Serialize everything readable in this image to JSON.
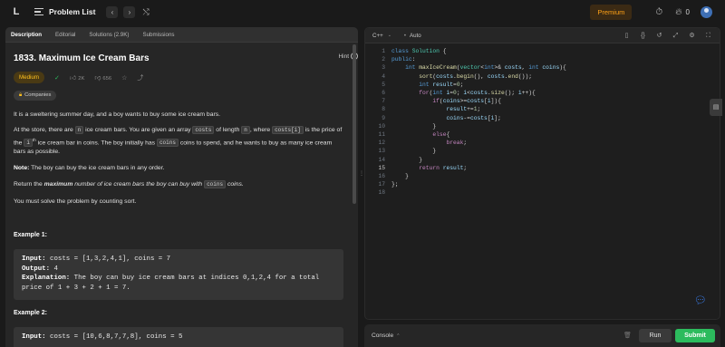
{
  "topbar": {
    "logo": "L",
    "title": "Problem List",
    "prev": "‹",
    "next": "›",
    "shuffle": "⤭",
    "premium": "Premium",
    "fire_count": "0"
  },
  "tabs": [
    "Description",
    "Editorial",
    "Solutions (2.9K)",
    "Submissions"
  ],
  "problem": {
    "title": "1833. Maximum Ice Cream Bars",
    "hint": "Hint",
    "difficulty": "Medium",
    "likes": "2K",
    "dislikes": "656",
    "companies": "Companies"
  },
  "description": {
    "p1": "It is a sweltering summer day, and a boy wants to buy some ice cream bars.",
    "p2_a": "At the store, there are ",
    "p2_n1": "n",
    "p2_b": " ice cream bars. You are given an array ",
    "p2_costs": "costs",
    "p2_c": " of length ",
    "p2_n2": "n",
    "p2_d": ", where ",
    "p2_costsi": "costs[i]",
    "p2_e": " is the price of the ",
    "p2_ith": "i",
    "p2_th": "th",
    "p2_f": " ice cream bar in coins. The boy initially has ",
    "p2_coins": "coins",
    "p2_g": " coins to spend, and he wants to buy as many ice cream bars as possible.",
    "note_label": "Note:",
    "note_text": " The boy can buy the ice cream bars in any order.",
    "ret_a": "Return the ",
    "ret_max": "maximum",
    "ret_b": " number of ice cream bars the boy can buy with ",
    "ret_coins": "coins",
    "ret_c": " coins.",
    "p5": "You must solve the problem by counting sort."
  },
  "examples": [
    {
      "heading": "Example 1:",
      "input_label": "Input:",
      "input": " costs = [1,3,2,4,1], coins = 7",
      "output_label": "Output:",
      "output": " 4",
      "expl_label": "Explanation:",
      "expl": " The boy can buy ice cream bars at indices 0,1,2,4 for a total",
      "expl2": "price of 1 + 3 + 2 + 1 = 7."
    },
    {
      "heading": "Example 2:",
      "input_label": "Input:",
      "input": " costs = [10,6,8,7,7,8], coins = 5"
    }
  ],
  "editor": {
    "language": "C++",
    "autosave": "Auto",
    "line_numbers": [
      "1",
      "2",
      "3",
      "4",
      "5",
      "6",
      "7",
      "8",
      "9",
      "10",
      "11",
      "12",
      "13",
      "14",
      "15",
      "16",
      "17",
      "18"
    ]
  },
  "console": {
    "label": "Console",
    "run": "Run",
    "submit": "Submit"
  }
}
